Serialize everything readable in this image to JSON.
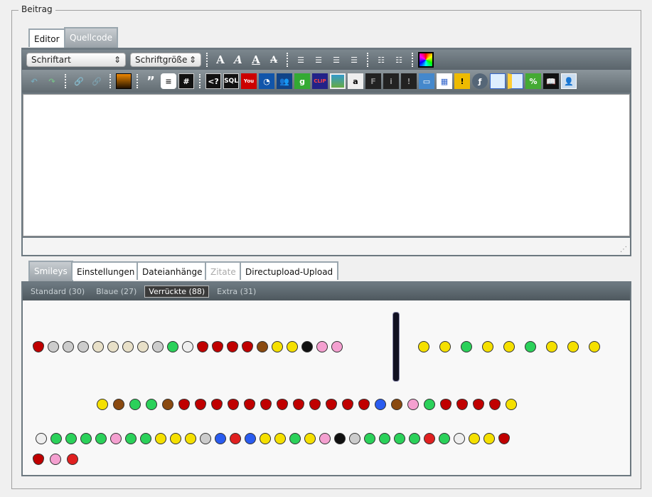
{
  "fieldset": {
    "legend": "Beitrag"
  },
  "editor_tabs": [
    {
      "label": "Editor",
      "state": "normal"
    },
    {
      "label": "Quellcode",
      "state": "active"
    }
  ],
  "toolbar": {
    "font_select": "Schriftart",
    "size_select": "Schriftgröße",
    "row1_icons": [
      "bold-icon",
      "italic-icon",
      "underline-icon",
      "strikethrough-icon",
      "align-left-icon",
      "align-center-icon",
      "align-right-icon",
      "justify-icon",
      "bullet-list-icon",
      "numbered-list-icon",
      "color-picker-icon"
    ],
    "row2_icons": [
      "undo-icon",
      "redo-icon",
      "link-icon",
      "unlink-icon",
      "image-icon",
      "quote-icon",
      "comment-icon",
      "hash-icon",
      "php-icon",
      "sql-icon",
      "youtube-icon",
      "clock-icon",
      "myspace-icon",
      "google-icon",
      "clipfish-icon",
      "picture-icon",
      "amazon-icon",
      "f-icon",
      "info-icon",
      "warning-icon",
      "folder-icon",
      "table-icon",
      "alert-icon",
      "flash-icon",
      "window-icon",
      "sidebar-icon",
      "percent-icon",
      "book-icon",
      "user-icon"
    ]
  },
  "bottom_tabs": [
    {
      "label": "Smileys",
      "state": "active"
    },
    {
      "label": "Einstellungen",
      "state": "normal"
    },
    {
      "label": "Dateianhänge",
      "state": "normal"
    },
    {
      "label": "Zitate",
      "state": "disabled"
    },
    {
      "label": "Directupload-Upload",
      "state": "normal"
    }
  ],
  "smiley_categories": [
    {
      "label": "Standard (30)"
    },
    {
      "label": "Blaue (27)"
    },
    {
      "label": "Verrückte (88)",
      "active": true
    },
    {
      "label": "Extra (31)"
    }
  ],
  "smiley_rows": [
    [
      "d",
      "a",
      "a",
      "a",
      "s",
      "s",
      "s",
      "s",
      "a",
      "g",
      "w",
      "d",
      "d",
      "d",
      "d",
      "o",
      "y",
      "y",
      "k",
      "p",
      "p"
    ],
    [
      "y",
      "y",
      "g",
      "y",
      "y",
      "g",
      "y",
      "y",
      "y"
    ],
    [
      "y",
      "o",
      "g",
      "g",
      "o",
      "d",
      "d",
      "d",
      "d",
      "d",
      "d",
      "d",
      "d",
      "d",
      "d",
      "d",
      "d",
      "b",
      "o",
      "p",
      "g",
      "d",
      "d",
      "d",
      "d",
      "y"
    ],
    [
      "w",
      "g",
      "g",
      "g",
      "g",
      "p",
      "g",
      "g",
      "y",
      "y",
      "y",
      "a",
      "b",
      "r",
      "b",
      "y",
      "y",
      "g",
      "y",
      "p",
      "k",
      "a",
      "g",
      "g",
      "g",
      "g",
      "r",
      "g",
      "w",
      "y",
      "y",
      "d"
    ],
    [
      "d",
      "p",
      "r"
    ]
  ]
}
